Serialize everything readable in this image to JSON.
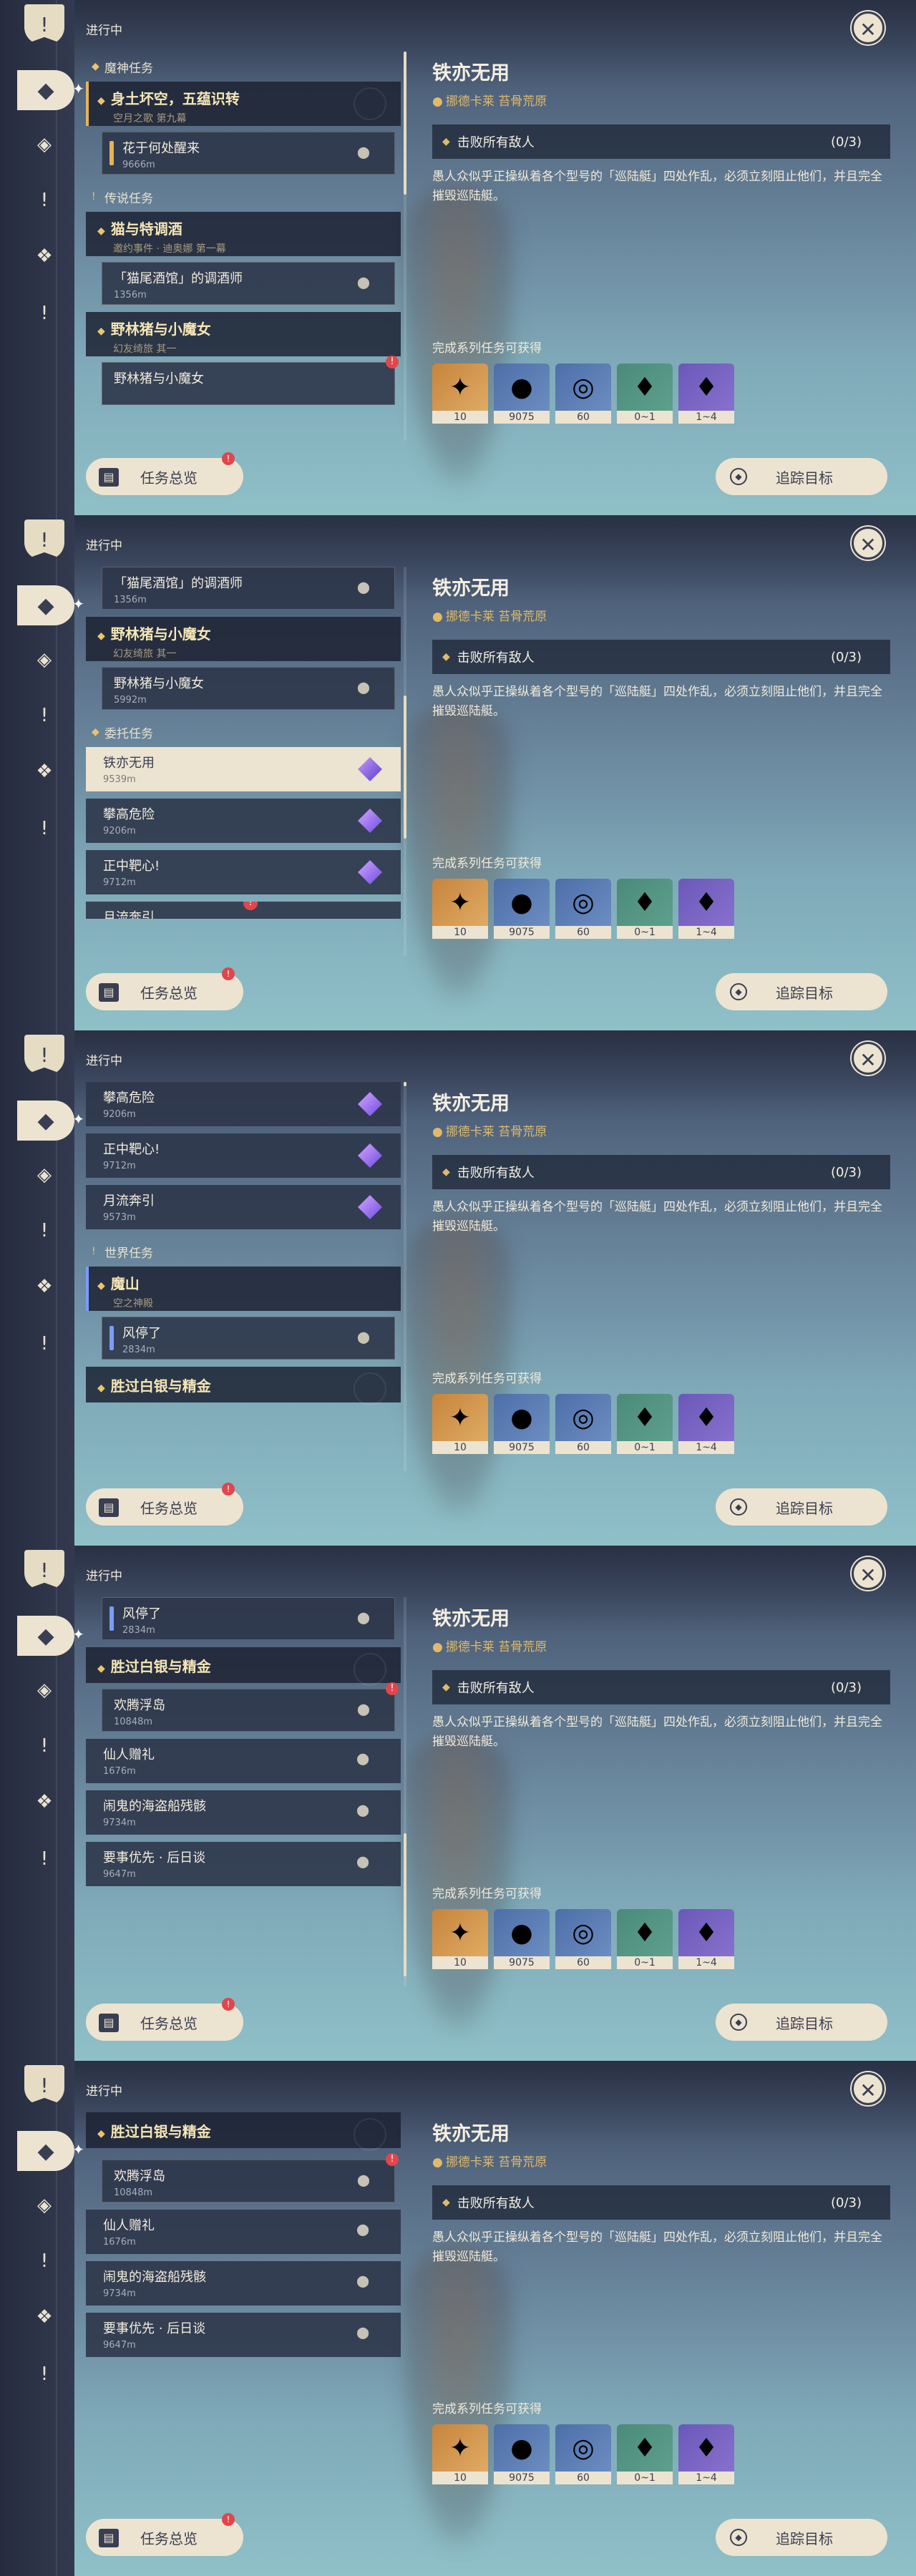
{
  "header": {
    "in_progress": "进行中"
  },
  "detail": {
    "title": "铁亦无用",
    "location": "挪德卡莱 苔骨荒原",
    "objective": "击败所有敌人",
    "progress": "(0/3)",
    "description": "愚人众似乎正操纵着各个型号的「巡陆艇」四处作乱，必须立刻阻止他们，并且完全摧毁巡陆艇。",
    "rewards_label": "完成系列任务可获得",
    "rewards": [
      {
        "icon": "primogem-icon",
        "count": "10"
      },
      {
        "icon": "mora-icon",
        "count": "9075"
      },
      {
        "icon": "adventure-exp-icon",
        "count": "60"
      },
      {
        "icon": "crystal-icon",
        "count": "0~1"
      },
      {
        "icon": "crystal-cluster-icon",
        "count": "1~4"
      }
    ]
  },
  "buttons": {
    "overview": "任务总览",
    "track": "追踪目标"
  },
  "categories": {
    "archon": "魔神任务",
    "story": "传说任务",
    "commission": "委托任务",
    "world": "世界任务"
  },
  "quests": {
    "archon_chapter": {
      "title": "身土坏空，五蕴识转",
      "sub": "空月之歌 第九幕"
    },
    "archon_step": {
      "title": "花于何处醒来",
      "dist": "9666m"
    },
    "story1_chapter": {
      "title": "猫与特调酒",
      "sub": "邀约事件 · 迪奥娜 第一幕"
    },
    "story1_step": {
      "title": "「猫尾酒馆」的调酒师",
      "dist": "1356m"
    },
    "story2_chapter": {
      "title": "野林猪与小魔女",
      "sub": "幻友绮旅 其一"
    },
    "story2_step": {
      "title": "野林猪与小魔女",
      "dist": "5992m"
    },
    "comm1": {
      "title": "铁亦无用",
      "dist": "9539m"
    },
    "comm2": {
      "title": "攀高危险",
      "dist": "9206m"
    },
    "comm3": {
      "title": "正中靶心!",
      "dist": "9712m"
    },
    "comm4": {
      "title": "月流奔引",
      "dist": "9573m"
    },
    "world1_chapter": {
      "title": "魔山",
      "sub": "空之神殿"
    },
    "world1_step": {
      "title": "风停了",
      "dist": "2834m"
    },
    "world2_chapter": {
      "title": "胜过白银与精金"
    },
    "world2_step": {
      "title": "欢腾浮岛",
      "dist": "10848m"
    },
    "w3": {
      "title": "仙人赠礼",
      "dist": "1676m"
    },
    "w4": {
      "title": "闹鬼的海盗船残骸",
      "dist": "9734m"
    },
    "w5": {
      "title": "要事优先 · 后日谈",
      "dist": "9647m"
    }
  },
  "colors": {
    "accent_gold": "#e6b457",
    "panel": "#1c2232",
    "button": "#ece4d0",
    "alert": "#e0464c"
  }
}
